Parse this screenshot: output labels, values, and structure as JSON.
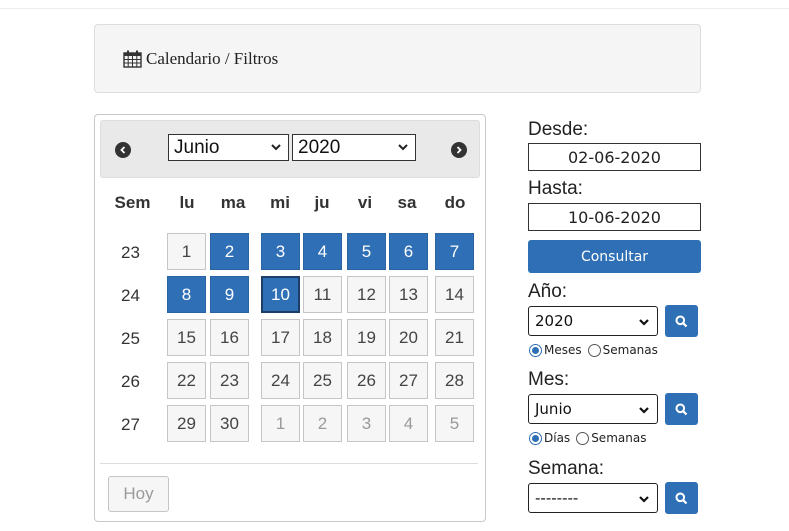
{
  "header": {
    "title": "Calendario / Filtros",
    "icon": "calendar-icon"
  },
  "calendar": {
    "month": "Junio",
    "year": "2020",
    "weekday_header": [
      "Sem",
      "lu",
      "ma",
      "mi",
      "ju",
      "vi",
      "sa",
      "do"
    ],
    "weeks": [
      {
        "num": "23",
        "days": [
          "1",
          "2",
          "3",
          "4",
          "5",
          "6",
          "7"
        ]
      },
      {
        "num": "24",
        "days": [
          "8",
          "9",
          "10",
          "11",
          "12",
          "13",
          "14"
        ]
      },
      {
        "num": "25",
        "days": [
          "15",
          "16",
          "17",
          "18",
          "19",
          "20",
          "21"
        ]
      },
      {
        "num": "26",
        "days": [
          "22",
          "23",
          "24",
          "25",
          "26",
          "27",
          "28"
        ]
      },
      {
        "num": "27",
        "days": [
          "29",
          "30",
          "1",
          "2",
          "3",
          "4",
          "5"
        ]
      }
    ],
    "today_label": "Hoy",
    "accent_color": "#2f6fb5"
  },
  "filters": {
    "desde_label": "Desde:",
    "desde_value": "02-06-2020",
    "hasta_label": "Hasta:",
    "hasta_value": "10-06-2020",
    "consultar_label": "Consultar",
    "anio_label": "Año:",
    "anio_value": "2020",
    "anio_radio_1": "Meses",
    "anio_radio_2": "Semanas",
    "mes_label": "Mes:",
    "mes_value": "Junio",
    "mes_radio_1": "Días",
    "mes_radio_2": "Semanas",
    "semana_label": "Semana:",
    "semana_value": "--------"
  }
}
